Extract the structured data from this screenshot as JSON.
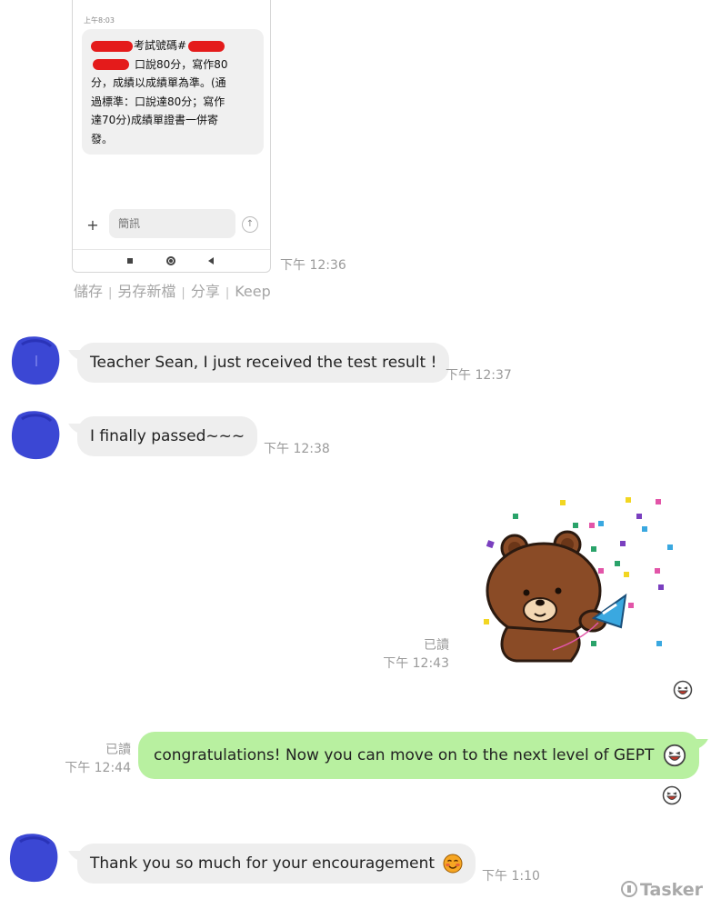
{
  "phone_screenshot": {
    "message_time": "上午8:03",
    "message_lines": [
      "考試號碼#",
      "口說80分，寫作80",
      "分，成績以成績單為準。(通",
      "過標準：口說達80分；寫作",
      "達70分)成績單證書一併寄",
      "發。"
    ],
    "input_placeholder": "簡訊",
    "plus_label": "+",
    "send_label": "↑"
  },
  "image_time": "下午 12:36",
  "image_actions": [
    "儲存",
    "另存新檔",
    "分享",
    "Keep"
  ],
  "action_separator": "|",
  "messages": [
    {
      "text": "Teacher Sean, I just received the test result !",
      "time": "下午 12:37"
    },
    {
      "text": "I finally passed~~~",
      "time": "下午 12:38"
    },
    {
      "read": "已讀",
      "time": "下午 12:43"
    },
    {
      "text": "congratulations! Now you can move on to the next level of GEPT",
      "read": "已讀",
      "time": "下午 12:44"
    },
    {
      "text": "Thank you so much for your encouragement",
      "time": "下午 1:10"
    }
  ],
  "watermark": "Tasker",
  "colors": {
    "outgoing_bubble": "#b8f0a0",
    "incoming_bubble": "#eeeeee",
    "avatar": "#3b47d4",
    "redaction": "#e41b1b"
  }
}
